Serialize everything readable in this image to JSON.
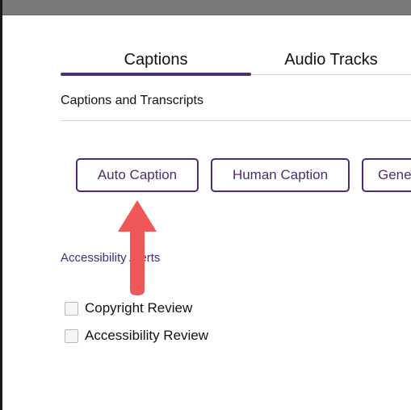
{
  "tabs": [
    {
      "label": "Captions",
      "active": true
    },
    {
      "label": "Audio Tracks",
      "active": false
    }
  ],
  "section": {
    "title": "Captions and Transcripts"
  },
  "buttons": {
    "auto_caption": "Auto Caption",
    "human_caption": "Human Caption",
    "generate": "Gene"
  },
  "accessibility": {
    "link_label": "Accessibility Alerts"
  },
  "checkboxes": [
    {
      "label": "Copyright Review",
      "checked": false
    },
    {
      "label": "Accessibility Review",
      "checked": false
    }
  ],
  "colors": {
    "accent": "#4f2b75",
    "link": "#3f2c7d",
    "arrow": "#f0575a"
  },
  "icons": {
    "annotation": "red-up-arrow-icon"
  }
}
